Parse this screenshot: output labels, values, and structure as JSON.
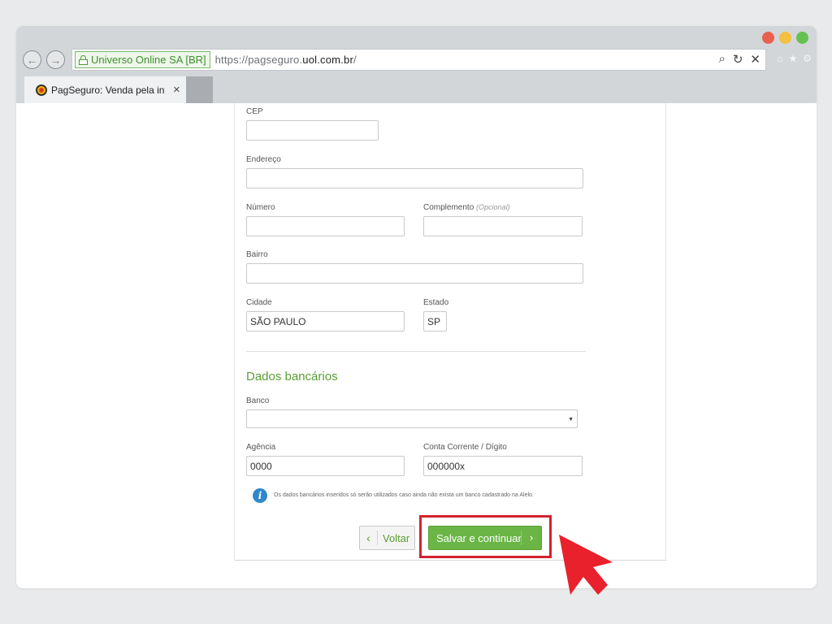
{
  "browser": {
    "ssl_label": "Universo Online SA [BR]",
    "url_prefix": "https://pagseguro.",
    "url_domain": "uol.com.br",
    "url_suffix": "/",
    "tab_title": "PagSeguro: Venda pela internet",
    "tab_close": "×"
  },
  "form": {
    "cep": {
      "label": "CEP",
      "value": ""
    },
    "endereco": {
      "label": "Endereço",
      "value": ""
    },
    "numero": {
      "label": "Número",
      "value": ""
    },
    "complemento": {
      "label": "Complemento",
      "optional": "(Opcional)",
      "value": ""
    },
    "bairro": {
      "label": "Bairro",
      "value": ""
    },
    "cidade": {
      "label": "Cidade",
      "value": "SÃO PAULO"
    },
    "estado": {
      "label": "Estado",
      "value": "SP"
    }
  },
  "bank": {
    "section_title": "Dados bancários",
    "banco": {
      "label": "Banco",
      "value": ""
    },
    "agencia": {
      "label": "Agência",
      "value": "0000"
    },
    "conta": {
      "label": "Conta Corrente / Dígito",
      "value": "000000x"
    },
    "info": "Os dados bancários inseridos só serão utilizados caso ainda não exista um banco cadastrado na Alelo."
  },
  "actions": {
    "back_label": "Voltar",
    "save_label": "Salvar e continuar"
  },
  "colors": {
    "accent_green": "#6ab545",
    "highlight_red": "#d3222e",
    "pointer_red": "#e8212c"
  }
}
